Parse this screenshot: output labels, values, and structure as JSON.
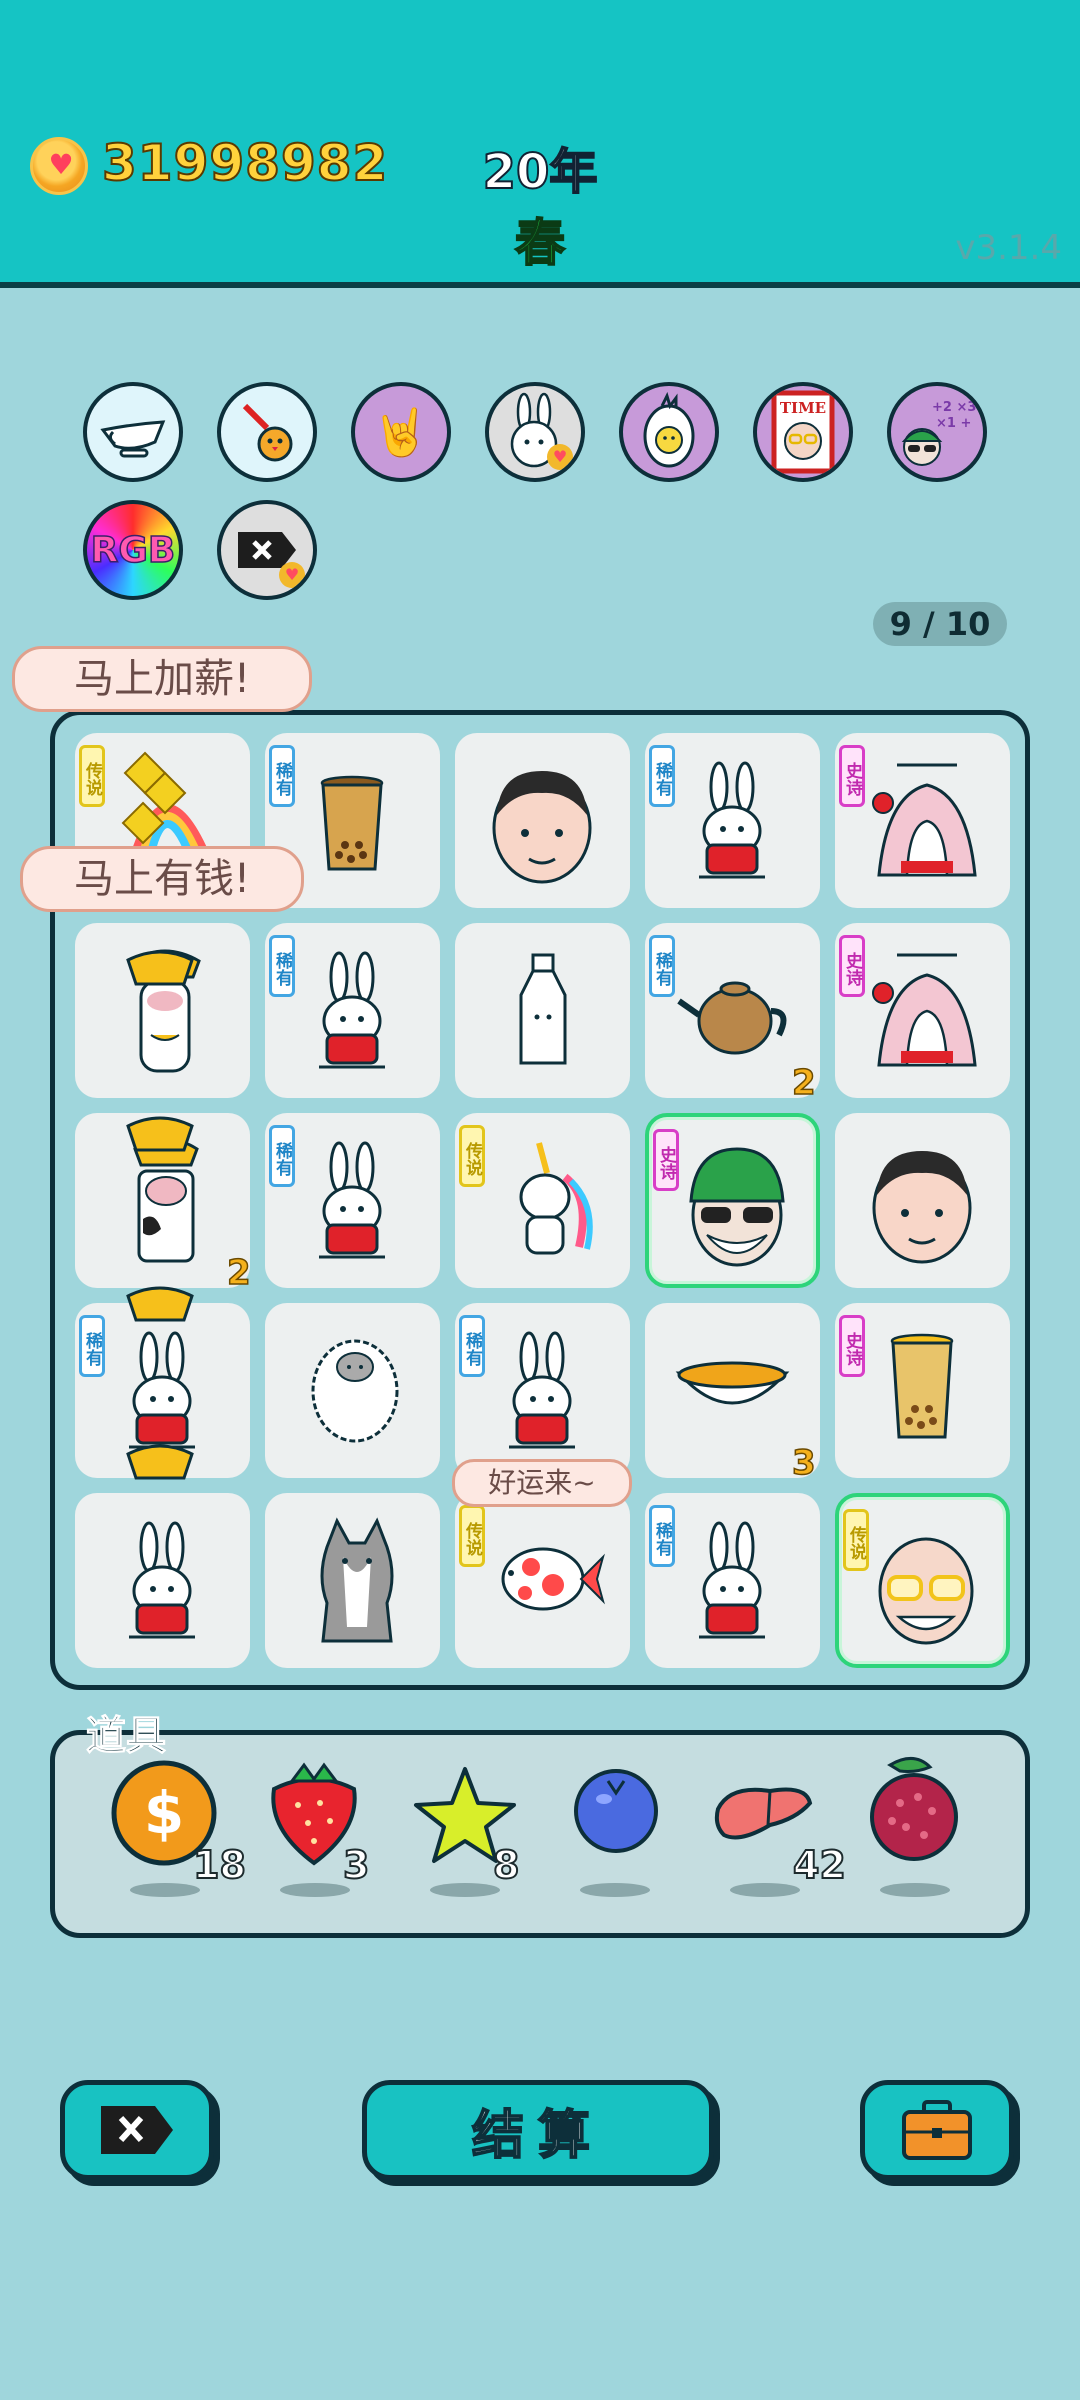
{
  "header": {
    "coins": "31998982",
    "year": "20年",
    "season": "春",
    "version": "v3.1.4"
  },
  "badges": [
    {
      "name": "gravy-boat-icon",
      "bg": "#dff5fb"
    },
    {
      "name": "chick-syringe-icon",
      "bg": "#dff5fb"
    },
    {
      "name": "rock-hand-icon",
      "bg": "#c79ad9"
    },
    {
      "name": "rabbit-heart-icon",
      "bg": "#dedede"
    },
    {
      "name": "egg-icon",
      "bg": "#c79ad9"
    },
    {
      "name": "time-magazine-icon",
      "bg": "#c79ad9"
    },
    {
      "name": "math-face-icon",
      "bg": "#c79ad9"
    },
    {
      "name": "rgb-icon",
      "text": "RGB"
    },
    {
      "name": "delete-tag-icon",
      "bg": "#dedede"
    }
  ],
  "counter": "9 / 10",
  "board": {
    "tags": {
      "rare": "稀有",
      "legend": "传说",
      "epic": "史诗"
    },
    "cells": [
      {
        "item": "unicorn-cloud",
        "tag": "legend"
      },
      {
        "item": "bubble-tea",
        "tag": "rare"
      },
      {
        "item": "man-face",
        "tag": ""
      },
      {
        "item": "rabbit",
        "tag": "rare"
      },
      {
        "item": "rabbit-house",
        "tag": "epic"
      },
      {
        "item": "cow-gold",
        "tag": ""
      },
      {
        "item": "rabbit",
        "tag": "rare"
      },
      {
        "item": "milk-bottle",
        "tag": ""
      },
      {
        "item": "teapot",
        "tag": "rare",
        "count": "2"
      },
      {
        "item": "rabbit-house",
        "tag": "epic"
      },
      {
        "item": "cow",
        "tag": "",
        "count": "2"
      },
      {
        "item": "rabbit",
        "tag": "rare"
      },
      {
        "item": "unicorn",
        "tag": "legend"
      },
      {
        "item": "green-cap-man",
        "tag": "epic",
        "highlight": true
      },
      {
        "item": "man-face",
        "tag": ""
      },
      {
        "item": "rabbit-gold",
        "tag": "rare"
      },
      {
        "item": "sheep",
        "tag": ""
      },
      {
        "item": "rabbit",
        "tag": "rare"
      },
      {
        "item": "soup-bowl",
        "tag": "",
        "count": "3"
      },
      {
        "item": "bubble-tea",
        "tag": "epic"
      },
      {
        "item": "rabbit",
        "tag": ""
      },
      {
        "item": "husky",
        "tag": ""
      },
      {
        "item": "koi-fish",
        "tag": "legend"
      },
      {
        "item": "rabbit",
        "tag": "rare"
      },
      {
        "item": "bald-man-glasses",
        "tag": "legend",
        "highlight": true
      }
    ],
    "bubbles": {
      "raise": "马上加薪!",
      "money": "马上有钱!",
      "luck": "好运来~"
    }
  },
  "items": {
    "title": "道具",
    "list": [
      {
        "name": "dollar-coin",
        "qty": "18"
      },
      {
        "name": "strawberry",
        "qty": "3"
      },
      {
        "name": "star",
        "qty": "8"
      },
      {
        "name": "blueberry",
        "qty": ""
      },
      {
        "name": "liver",
        "qty": "42"
      },
      {
        "name": "waxberry",
        "qty": ""
      }
    ]
  },
  "buttons": {
    "settle": "结算"
  },
  "colors": {
    "bg": "#9fd6dc",
    "header": "#15c4c4",
    "accent": "#18c2c2",
    "coin_text": "#ffd23c",
    "season": "#23d84a"
  }
}
